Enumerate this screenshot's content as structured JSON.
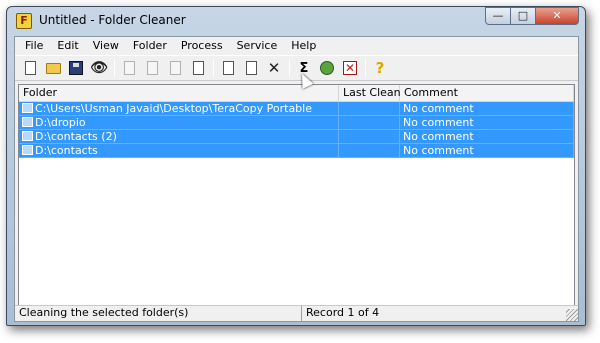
{
  "window": {
    "title": "Untitled - Folder Cleaner",
    "app_icon": "folder-cleaner-app-icon",
    "buttons": {
      "minimize": "—",
      "maximize": "□",
      "close": "✕"
    }
  },
  "menubar": {
    "items": [
      "File",
      "Edit",
      "View",
      "Folder",
      "Process",
      "Service",
      "Help"
    ]
  },
  "toolbar": {
    "buttons": [
      {
        "name": "new-icon",
        "enabled": true
      },
      {
        "name": "open-icon",
        "enabled": true
      },
      {
        "name": "save-icon",
        "enabled": true
      },
      {
        "name": "find-icon",
        "enabled": true
      },
      {
        "name": "copy-icon",
        "enabled": false
      },
      {
        "name": "cut-icon",
        "enabled": false
      },
      {
        "name": "paste-icon",
        "enabled": false
      },
      {
        "name": "properties-icon",
        "enabled": true
      },
      {
        "name": "preview-icon",
        "enabled": true
      },
      {
        "name": "edit-icon",
        "enabled": true
      },
      {
        "name": "delete-icon",
        "enabled": true
      },
      {
        "name": "sum-icon",
        "enabled": true
      },
      {
        "name": "clean-icon",
        "enabled": true
      },
      {
        "name": "stop-icon",
        "enabled": true
      },
      {
        "name": "help-icon",
        "enabled": true
      }
    ]
  },
  "grid": {
    "columns": [
      "Folder",
      "Last Clean",
      "Comment"
    ],
    "rows": [
      {
        "folder": "C:\\Users\\Usman Javaid\\Desktop\\TeraCopy Portable",
        "last_clean": "",
        "comment": "No comment",
        "selected": true
      },
      {
        "folder": "D:\\dropio",
        "last_clean": "",
        "comment": "No comment",
        "selected": true
      },
      {
        "folder": "D:\\contacts (2)",
        "last_clean": "",
        "comment": "No comment",
        "selected": true
      },
      {
        "folder": "D:\\contacts",
        "last_clean": "",
        "comment": "No comment",
        "selected": true
      }
    ]
  },
  "statusbar": {
    "message": "Cleaning the selected folder(s)",
    "record": "Record 1 of 4"
  },
  "colors": {
    "selection": "#3399ff",
    "window_frame": "#a9bdd3"
  }
}
